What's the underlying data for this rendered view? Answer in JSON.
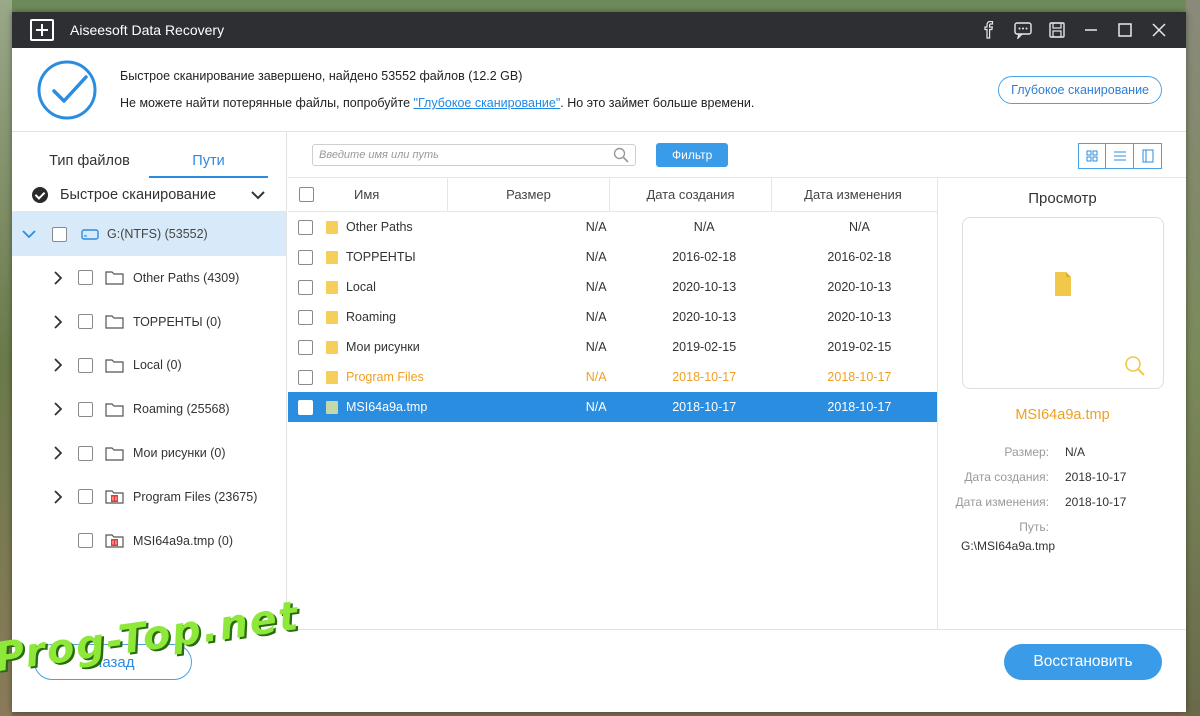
{
  "window": {
    "title": "Aiseesoft Data Recovery",
    "titlebar_icons": [
      "facebook-icon",
      "feedback-icon",
      "save-icon",
      "minimize-icon",
      "maximize-icon",
      "close-icon"
    ]
  },
  "scan": {
    "line1": "Быстрое сканирование завершено, найдено 53552 файлов (12.2 GB)",
    "line2_pre": "Не можете найти потерянные файлы, попробуйте ",
    "line2_link": "\"Глубокое сканирование\"",
    "line2_post": ". Но это займет больше времени.",
    "deep_button": "Глубокое сканирование"
  },
  "left_panel": {
    "tabs": [
      {
        "label": "Тип файлов",
        "active": false
      },
      {
        "label": "Пути",
        "active": true
      }
    ],
    "quick_scan": "Быстрое сканирование",
    "root": "G:(NTFS) (53552)",
    "items": [
      {
        "label": "Other Paths (4309)",
        "icon": "folder-icon"
      },
      {
        "label": "ТОРРЕНТЫ (0)",
        "icon": "folder-icon"
      },
      {
        "label": "Local (0)",
        "icon": "folder-icon"
      },
      {
        "label": "Roaming (25568)",
        "icon": "folder-icon"
      },
      {
        "label": "Мои рисунки (0)",
        "icon": "folder-icon"
      },
      {
        "label": "Program Files (23675)",
        "icon": "deleted-folder-icon"
      },
      {
        "label": "MSI64a9a.tmp (0)",
        "icon": "deleted-folder-icon"
      }
    ]
  },
  "toolbar": {
    "search_placeholder": "Введите имя или путь",
    "filter_button": "Фильтр"
  },
  "table": {
    "headers": {
      "name": "Имя",
      "size": "Размер",
      "created": "Дата создания",
      "modified": "Дата изменения"
    },
    "rows": [
      {
        "name": "Other Paths",
        "size": "N/A",
        "created": "N/A",
        "modified": "N/A",
        "state": "normal"
      },
      {
        "name": "ТОРРЕНТЫ",
        "size": "N/A",
        "created": "2016-02-18",
        "modified": "2016-02-18",
        "state": "normal"
      },
      {
        "name": "Local",
        "size": "N/A",
        "created": "2020-10-13",
        "modified": "2020-10-13",
        "state": "normal"
      },
      {
        "name": "Roaming",
        "size": "N/A",
        "created": "2020-10-13",
        "modified": "2020-10-13",
        "state": "normal"
      },
      {
        "name": "Мои рисунки",
        "size": "N/A",
        "created": "2019-02-15",
        "modified": "2019-02-15",
        "state": "normal"
      },
      {
        "name": "Program Files",
        "size": "N/A",
        "created": "2018-10-17",
        "modified": "2018-10-17",
        "state": "highlight"
      },
      {
        "name": "MSI64a9a.tmp",
        "size": "N/A",
        "created": "2018-10-17",
        "modified": "2018-10-17",
        "state": "selected"
      }
    ]
  },
  "preview": {
    "title": "Просмотр",
    "name": "MSI64a9a.tmp",
    "size_label": "Размер:",
    "size": "N/A",
    "created_label": "Дата создания:",
    "created": "2018-10-17",
    "modified_label": "Дата изменения:",
    "modified": "2018-10-17",
    "path_label": "Путь:",
    "path": "G:\\MSI64a9a.tmp"
  },
  "footer": {
    "back_button": "Назад",
    "restore_button": "Восстановить"
  },
  "watermark": "Prog-Top.net",
  "colors": {
    "accent": "#3a9be8",
    "highlight": "#f0a020",
    "selected": "#2a8de0",
    "titlebar": "#2d2f33"
  }
}
